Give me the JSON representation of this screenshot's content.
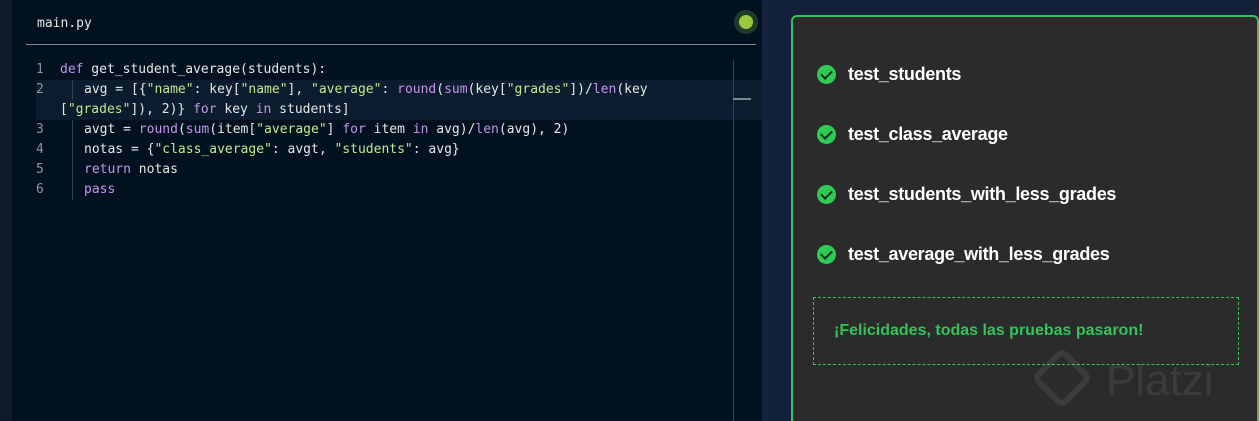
{
  "editor": {
    "file_name": "main.py",
    "status_color": "#98ca3f",
    "lines": [
      {
        "n": "1",
        "tokens": [
          {
            "t": "def",
            "c": "kw"
          },
          {
            "t": " get_student_average(students):",
            "c": "fn"
          }
        ]
      },
      {
        "n": "2",
        "tokens": [
          {
            "t": "avg = [{",
            "c": "fn"
          },
          {
            "t": "\"name\"",
            "c": "str"
          },
          {
            "t": ": key[",
            "c": "fn"
          },
          {
            "t": "\"name\"",
            "c": "str"
          },
          {
            "t": "], ",
            "c": "fn"
          },
          {
            "t": "\"average\"",
            "c": "str"
          },
          {
            "t": ": ",
            "c": "fn"
          },
          {
            "t": "round",
            "c": "kw"
          },
          {
            "t": "(",
            "c": "fn"
          },
          {
            "t": "sum",
            "c": "kw"
          },
          {
            "t": "(key[",
            "c": "fn"
          },
          {
            "t": "\"grades\"",
            "c": "str"
          },
          {
            "t": "])/",
            "c": "fn"
          },
          {
            "t": "len",
            "c": "kw"
          },
          {
            "t": "(key",
            "c": "fn"
          }
        ]
      },
      {
        "n": "",
        "tokens": [
          {
            "t": "[",
            "c": "fn"
          },
          {
            "t": "\"grades\"",
            "c": "str"
          },
          {
            "t": "]), 2)} ",
            "c": "fn"
          },
          {
            "t": "for",
            "c": "kw"
          },
          {
            "t": " key ",
            "c": "fn"
          },
          {
            "t": "in",
            "c": "kw"
          },
          {
            "t": " students]",
            "c": "fn"
          }
        ]
      },
      {
        "n": "3",
        "tokens": [
          {
            "t": "avgt = ",
            "c": "fn"
          },
          {
            "t": "round",
            "c": "kw"
          },
          {
            "t": "(",
            "c": "fn"
          },
          {
            "t": "sum",
            "c": "kw"
          },
          {
            "t": "(item[",
            "c": "fn"
          },
          {
            "t": "\"average\"",
            "c": "str"
          },
          {
            "t": "] ",
            "c": "fn"
          },
          {
            "t": "for",
            "c": "kw"
          },
          {
            "t": " item ",
            "c": "fn"
          },
          {
            "t": "in",
            "c": "kw"
          },
          {
            "t": " avg)/",
            "c": "fn"
          },
          {
            "t": "len",
            "c": "kw"
          },
          {
            "t": "(avg), 2)",
            "c": "fn"
          }
        ]
      },
      {
        "n": "4",
        "tokens": [
          {
            "t": "notas = {",
            "c": "fn"
          },
          {
            "t": "\"class_average\"",
            "c": "str"
          },
          {
            "t": ": avgt, ",
            "c": "fn"
          },
          {
            "t": "\"students\"",
            "c": "str"
          },
          {
            "t": ": avg}",
            "c": "fn"
          }
        ]
      },
      {
        "n": "5",
        "tokens": [
          {
            "t": "return",
            "c": "kw"
          },
          {
            "t": " notas",
            "c": "fn"
          }
        ]
      },
      {
        "n": "6",
        "tokens": [
          {
            "t": "pass",
            "c": "kw"
          }
        ]
      }
    ]
  },
  "tests": {
    "items": [
      {
        "label": "test_students",
        "status": "passed"
      },
      {
        "label": "test_class_average",
        "status": "passed"
      },
      {
        "label": "test_students_with_less_grades",
        "status": "passed"
      },
      {
        "label": "test_average_with_less_grades",
        "status": "passed"
      }
    ],
    "success_message": "¡Felicidades, todas las pruebas pasaron!"
  },
  "watermark": {
    "text": "Platzi"
  },
  "colors": {
    "accent": "#34c359",
    "panel_bg": "#2b2b2b",
    "editor_bg": "#02111f"
  }
}
